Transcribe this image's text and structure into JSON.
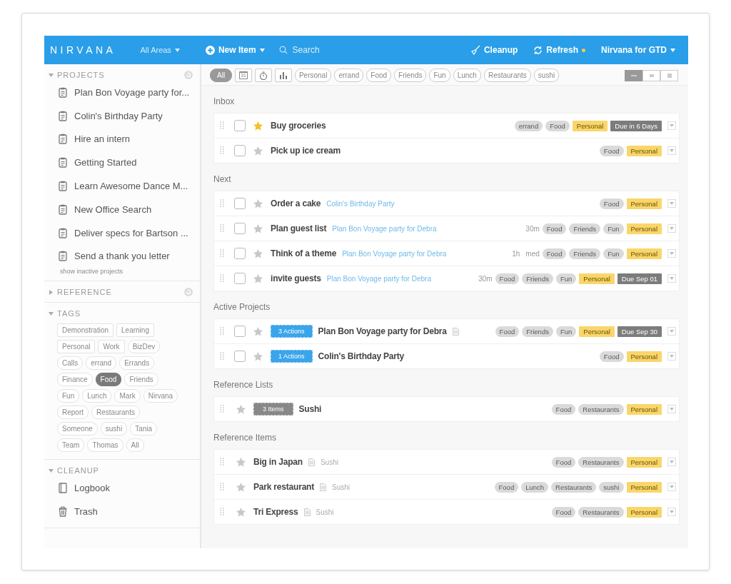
{
  "header": {
    "logo": "NIRVANA",
    "area_menu": "All Areas",
    "new_item": "New Item",
    "search": {
      "placeholder": "Search"
    },
    "cleanup": "Cleanup",
    "refresh": "Refresh",
    "account": "Nirvana for GTD"
  },
  "sidebar": {
    "sections": [
      {
        "title": "PROJECTS",
        "expanded": true,
        "kind": "projects",
        "items": [
          {
            "label": "Plan Bon Voyage party for..."
          },
          {
            "label": "Colin's Birthday Party"
          },
          {
            "label": "Hire an intern"
          },
          {
            "label": "Getting Started"
          },
          {
            "label": "Learn Awesome Dance M..."
          },
          {
            "label": "New Office Search"
          },
          {
            "label": "Deliver specs for Bartson ..."
          },
          {
            "label": "Send a thank you letter"
          }
        ],
        "footer_link": "show inactive projects"
      },
      {
        "title": "REFERENCE",
        "expanded": false,
        "kind": "reference"
      },
      {
        "title": "TAGS",
        "expanded": true,
        "kind": "tags",
        "tags": [
          {
            "label": "Demonstration",
            "kind": "area",
            "selected": false
          },
          {
            "label": "Learning",
            "kind": "area",
            "selected": false
          },
          {
            "label": "Personal",
            "kind": "area",
            "selected": false
          },
          {
            "label": "Work",
            "kind": "area",
            "selected": false
          },
          {
            "label": "BizDev",
            "kind": "tag",
            "selected": false
          },
          {
            "label": "Calls",
            "kind": "tag",
            "selected": false
          },
          {
            "label": "errand",
            "kind": "tag",
            "selected": false
          },
          {
            "label": "Errands",
            "kind": "tag",
            "selected": false
          },
          {
            "label": "Finance",
            "kind": "tag",
            "selected": false
          },
          {
            "label": "Food",
            "kind": "tag",
            "selected": true
          },
          {
            "label": "Friends",
            "kind": "tag",
            "selected": false
          },
          {
            "label": "Fun",
            "kind": "tag",
            "selected": false
          },
          {
            "label": "Lunch",
            "kind": "tag",
            "selected": false
          },
          {
            "label": "Mark",
            "kind": "tag",
            "selected": false
          },
          {
            "label": "Nirvana",
            "kind": "tag",
            "selected": false
          },
          {
            "label": "Report",
            "kind": "tag",
            "selected": false
          },
          {
            "label": "Restaurants",
            "kind": "tag",
            "selected": false
          },
          {
            "label": "Someone",
            "kind": "tag",
            "selected": false
          },
          {
            "label": "sushi",
            "kind": "tag",
            "selected": false
          },
          {
            "label": "Tania",
            "kind": "tag",
            "selected": false
          },
          {
            "label": "Team",
            "kind": "tag",
            "selected": false
          },
          {
            "label": "Thomas",
            "kind": "tag",
            "selected": false
          },
          {
            "label": "All",
            "kind": "tag",
            "selected": false
          }
        ]
      },
      {
        "title": "CLEANUP",
        "expanded": true,
        "kind": "cleanup",
        "items": [
          {
            "label": "Logbook",
            "kind": "logbook"
          },
          {
            "label": "Trash",
            "kind": "trash"
          }
        ]
      }
    ]
  },
  "filter_bar": {
    "chips": [
      {
        "kind": "text",
        "label": "All",
        "selected": true
      },
      {
        "kind": "calendar",
        "label": "31",
        "selected": false
      },
      {
        "kind": "timer",
        "selected": false
      },
      {
        "kind": "chart",
        "selected": false
      },
      {
        "kind": "tag",
        "label": "Personal",
        "selected": false
      },
      {
        "kind": "tag",
        "label": "errand",
        "selected": false
      },
      {
        "kind": "tag",
        "label": "Food",
        "selected": false
      },
      {
        "kind": "tag",
        "label": "Friends",
        "selected": false
      },
      {
        "kind": "tag",
        "label": "Fun",
        "selected": false
      },
      {
        "kind": "tag",
        "label": "Lunch",
        "selected": false
      },
      {
        "kind": "tag",
        "label": "Restaurants",
        "selected": false
      },
      {
        "kind": "tag",
        "label": "sushi",
        "selected": false
      }
    ],
    "view_modes": [
      {
        "kind": "compact",
        "selected": true
      },
      {
        "kind": "normal",
        "selected": false
      },
      {
        "kind": "expanded",
        "selected": false
      }
    ]
  },
  "sections": [
    {
      "title": "Inbox",
      "rows": [
        {
          "kind": "action",
          "checked": false,
          "starred": true,
          "title": "Buy groceries",
          "tags": [
            {
              "label": "errand",
              "kind": "tag"
            },
            {
              "label": "Food",
              "kind": "tag"
            },
            {
              "label": "Personal",
              "kind": "area"
            },
            {
              "label": "Due in 6 Days",
              "kind": "due"
            }
          ]
        },
        {
          "kind": "action",
          "checked": false,
          "starred": false,
          "title": "Pick up ice cream",
          "tags": [
            {
              "label": "Food",
              "kind": "tag"
            },
            {
              "label": "Personal",
              "kind": "area"
            }
          ]
        }
      ]
    },
    {
      "title": "Next",
      "rows": [
        {
          "kind": "action",
          "checked": false,
          "starred": false,
          "title": "Order a cake",
          "project": "Colin's Birthday Party",
          "tags": [
            {
              "label": "Food",
              "kind": "tag"
            },
            {
              "label": "Personal",
              "kind": "area"
            }
          ]
        },
        {
          "kind": "action",
          "checked": false,
          "starred": false,
          "title": "Plan guest list",
          "project": "Plan Bon Voyage party for Debra",
          "time": "30m",
          "tags": [
            {
              "label": "Food",
              "kind": "tag"
            },
            {
              "label": "Friends",
              "kind": "tag"
            },
            {
              "label": "Fun",
              "kind": "tag"
            },
            {
              "label": "Personal",
              "kind": "area"
            }
          ]
        },
        {
          "kind": "action",
          "checked": false,
          "starred": false,
          "title": "Think of a theme",
          "project": "Plan Bon Voyage party for Debra",
          "time": "1h",
          "energy": "med",
          "tags": [
            {
              "label": "Food",
              "kind": "tag"
            },
            {
              "label": "Friends",
              "kind": "tag"
            },
            {
              "label": "Fun",
              "kind": "tag"
            },
            {
              "label": "Personal",
              "kind": "area"
            }
          ]
        },
        {
          "kind": "action",
          "checked": false,
          "starred": false,
          "title": "invite guests",
          "project": "Plan Bon Voyage party for Debra",
          "time": "30m",
          "tags": [
            {
              "label": "Food",
              "kind": "tag"
            },
            {
              "label": "Friends",
              "kind": "tag"
            },
            {
              "label": "Fun",
              "kind": "tag"
            },
            {
              "label": "Personal",
              "kind": "area"
            },
            {
              "label": "Due Sep 01",
              "kind": "due"
            }
          ]
        }
      ]
    },
    {
      "title": "Active Projects",
      "rows": [
        {
          "kind": "project",
          "checked": false,
          "starred": false,
          "badge": "3 Actions",
          "title": "Plan Bon Voyage party for Debra",
          "has_note": true,
          "tags": [
            {
              "label": "Food",
              "kind": "tag"
            },
            {
              "label": "Friends",
              "kind": "tag"
            },
            {
              "label": "Fun",
              "kind": "tag"
            },
            {
              "label": "Personal",
              "kind": "area"
            },
            {
              "label": "Due Sep 30",
              "kind": "due"
            }
          ]
        },
        {
          "kind": "project",
          "checked": false,
          "starred": false,
          "badge": "1 Actions",
          "title": "Colin's Birthday Party",
          "tags": [
            {
              "label": "Food",
              "kind": "tag"
            },
            {
              "label": "Personal",
              "kind": "area"
            }
          ]
        }
      ]
    },
    {
      "title": "Reference Lists",
      "rows": [
        {
          "kind": "reference_list",
          "starred": false,
          "badge": "3 Items",
          "title": "Sushi",
          "tags": [
            {
              "label": "Food",
              "kind": "tag"
            },
            {
              "label": "Restaurants",
              "kind": "tag"
            },
            {
              "label": "Personal",
              "kind": "area"
            }
          ]
        }
      ]
    },
    {
      "title": "Reference Items",
      "rows": [
        {
          "kind": "reference_item",
          "starred": false,
          "title": "Big in Japan",
          "has_note": true,
          "parent": "Sushi",
          "tags": [
            {
              "label": "Food",
              "kind": "tag"
            },
            {
              "label": "Restaurants",
              "kind": "tag"
            },
            {
              "label": "Personal",
              "kind": "area"
            }
          ]
        },
        {
          "kind": "reference_item",
          "starred": false,
          "title": "Park restaurant",
          "has_note": true,
          "parent": "Sushi",
          "tags": [
            {
              "label": "Food",
              "kind": "tag"
            },
            {
              "label": "Lunch",
              "kind": "tag"
            },
            {
              "label": "Restaurants",
              "kind": "tag"
            },
            {
              "label": "sushi",
              "kind": "tag"
            },
            {
              "label": "Personal",
              "kind": "area"
            }
          ]
        },
        {
          "kind": "reference_item",
          "starred": false,
          "title": "Tri Express",
          "has_note": true,
          "parent": "Sushi",
          "tags": [
            {
              "label": "Food",
              "kind": "tag"
            },
            {
              "label": "Restaurants",
              "kind": "tag"
            },
            {
              "label": "Personal",
              "kind": "area"
            }
          ]
        }
      ]
    }
  ]
}
